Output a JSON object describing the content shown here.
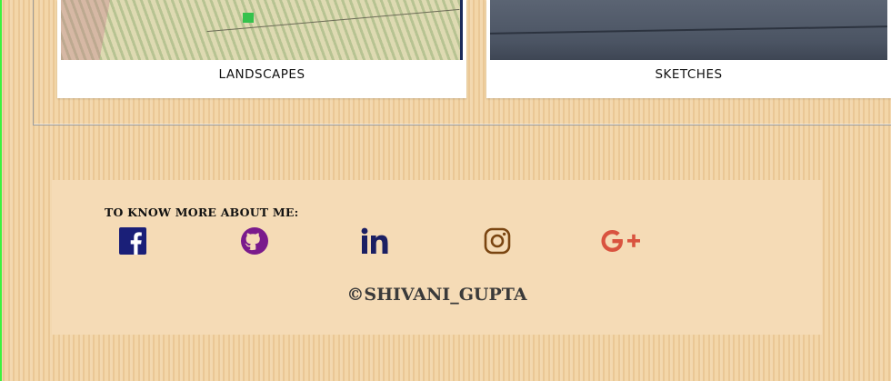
{
  "gallery": {
    "cards": [
      {
        "caption": "LANDSCAPES"
      },
      {
        "caption": "SKETCHES"
      }
    ]
  },
  "footer": {
    "heading": "TO KNOW MORE ABOUT ME:",
    "social_icons": [
      "facebook-icon",
      "github-icon",
      "linkedin-icon",
      "instagram-icon",
      "google-plus-icon"
    ],
    "copyright": "©SHIVANI_GUPTA"
  },
  "colors": {
    "facebook": "#1a1f78",
    "github": "#7a1a8c",
    "linkedin": "#1b1f63",
    "instagram": "#7a4511",
    "google_plus": "#d9533f"
  }
}
